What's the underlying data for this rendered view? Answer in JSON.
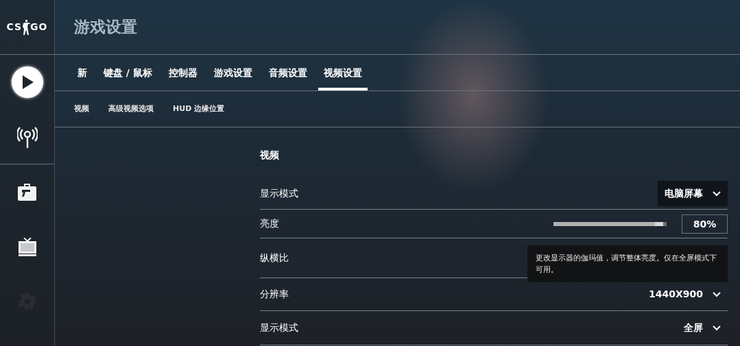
{
  "logo": {
    "left": "CS",
    "right": "GO"
  },
  "sidebar": {
    "items": [
      {
        "kind": "play",
        "selected": true,
        "disabled": false
      },
      {
        "kind": "antenna",
        "selected": false,
        "disabled": false
      },
      {
        "kind": "briefcase",
        "selected": false,
        "disabled": false
      },
      {
        "kind": "tv",
        "selected": false,
        "disabled": false
      },
      {
        "kind": "gear",
        "selected": false,
        "disabled": true
      }
    ]
  },
  "header": {
    "title": "游戏设置"
  },
  "tabs": [
    {
      "label": "新",
      "selected": false
    },
    {
      "label": "键盘 / 鼠标",
      "selected": false
    },
    {
      "label": "控制器",
      "selected": false
    },
    {
      "label": "游戏设置",
      "selected": false
    },
    {
      "label": "音频设置",
      "selected": false
    },
    {
      "label": "视频设置",
      "selected": true
    }
  ],
  "subtabs": [
    {
      "label": "视频"
    },
    {
      "label": "高级视频选项"
    },
    {
      "label": "HUD 边缘位置"
    }
  ],
  "section": {
    "title": "视频"
  },
  "rows": [
    {
      "kind": "dropdown",
      "label": "显示模式",
      "value": "电脑屏幕",
      "highlighted": true,
      "disabled": false
    },
    {
      "kind": "slider",
      "label": "亮度",
      "level": 0.97,
      "reading": "80%"
    },
    {
      "kind": "plain",
      "label": "纵横比"
    },
    {
      "kind": "dropdown",
      "label": "分辨率",
      "value": "1440X900",
      "highlighted": false,
      "disabled": false
    },
    {
      "kind": "dropdown",
      "label": "显示模式",
      "value": "全屏",
      "highlighted": false,
      "disabled": false
    }
  ],
  "tooltip": {
    "text": "更改显示器的伽玛值，调节整体亮度。仅在全屏模式下可用。"
  }
}
